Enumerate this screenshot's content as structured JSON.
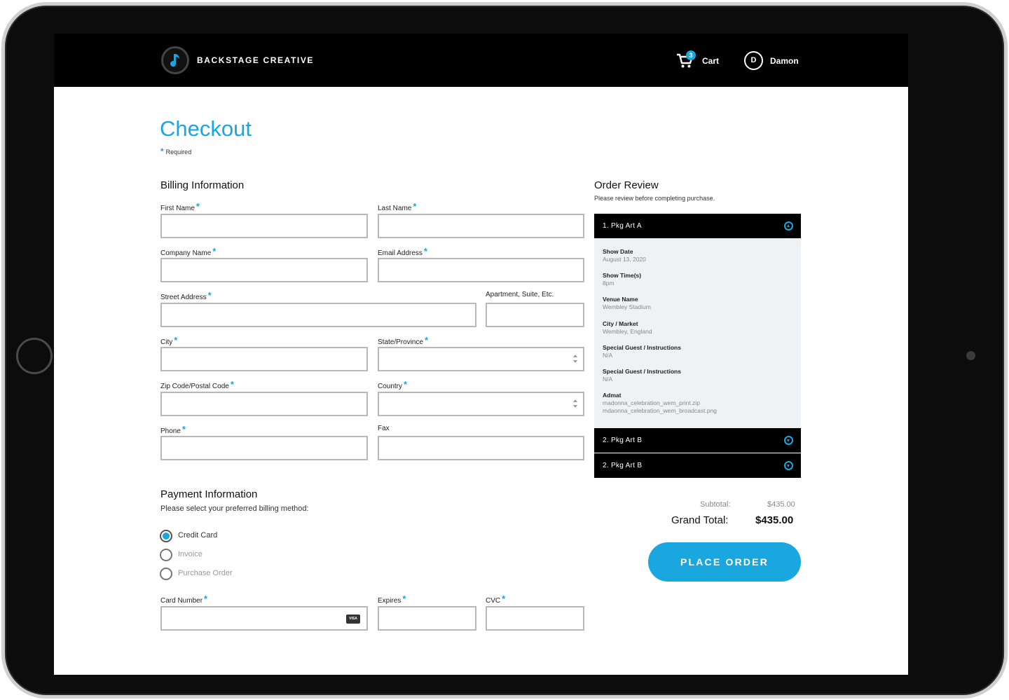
{
  "header": {
    "brand": "BACKSTAGE CREATIVE",
    "logo_icon": "music-note-icon",
    "cart_icon": "cart-icon",
    "cart_count": "3",
    "cart_label": "Cart",
    "user_initial": "D",
    "user_name": "Damon"
  },
  "page": {
    "title": "Checkout",
    "required_marker": "*",
    "required_note": "Required"
  },
  "billing": {
    "title": "Billing Information",
    "fields": {
      "first_name": "First Name",
      "last_name": "Last Name",
      "company_name": "Company Name",
      "email_address": "Email Address",
      "street_address": "Street Address",
      "apartment": "Apartment, Suite, Etc.",
      "city": "City",
      "state": "State/Province",
      "zip": "Zip Code/Postal Code",
      "country": "Country",
      "phone": "Phone",
      "fax": "Fax"
    }
  },
  "payment": {
    "title": "Payment Information",
    "subtitle": "Please select your preferred billing method:",
    "methods": [
      {
        "label": "Credit Card",
        "selected": true
      },
      {
        "label": "Invoice",
        "selected": false
      },
      {
        "label": "Purchase Order",
        "selected": false
      }
    ],
    "card_number": "Card Number",
    "card_icon": "VISA",
    "expires": "Expires",
    "cvc": "CVC"
  },
  "order_review": {
    "title": "Order Review",
    "subtitle": "Please review before completing purchase.",
    "packages": [
      {
        "title": "1. Pkg Art A",
        "expanded": true
      },
      {
        "title": "2. Pkg Art B",
        "expanded": false
      },
      {
        "title": "2. Pkg Art B",
        "expanded": false
      }
    ],
    "details": [
      {
        "label": "Show Date",
        "value": "August 13, 2020"
      },
      {
        "label": "Show Time(s)",
        "value": "8pm"
      },
      {
        "label": "Venue Name",
        "value": "Wembley Stadium"
      },
      {
        "label": "City / Market",
        "value": "Wembley, England"
      },
      {
        "label": "Special Guest / Instructions",
        "value": "N/A"
      },
      {
        "label": "Special Guest / Instructions",
        "value": "N/A"
      }
    ],
    "admat": {
      "label": "Admat",
      "files": [
        "madonna_celebration_wem_print.zip",
        "mdaonna_celebration_wem_broadcast.png"
      ]
    }
  },
  "totals": {
    "subtotal_label": "Subtotal:",
    "subtotal_value": "$435.00",
    "grand_total_label": "Grand Total:",
    "grand_total_value": "$435.00"
  },
  "actions": {
    "place_order": "PLACE ORDER"
  },
  "colors": {
    "accent": "#1aa6df",
    "header_bg": "#000000",
    "review_panel_bg": "#eef2f5"
  }
}
